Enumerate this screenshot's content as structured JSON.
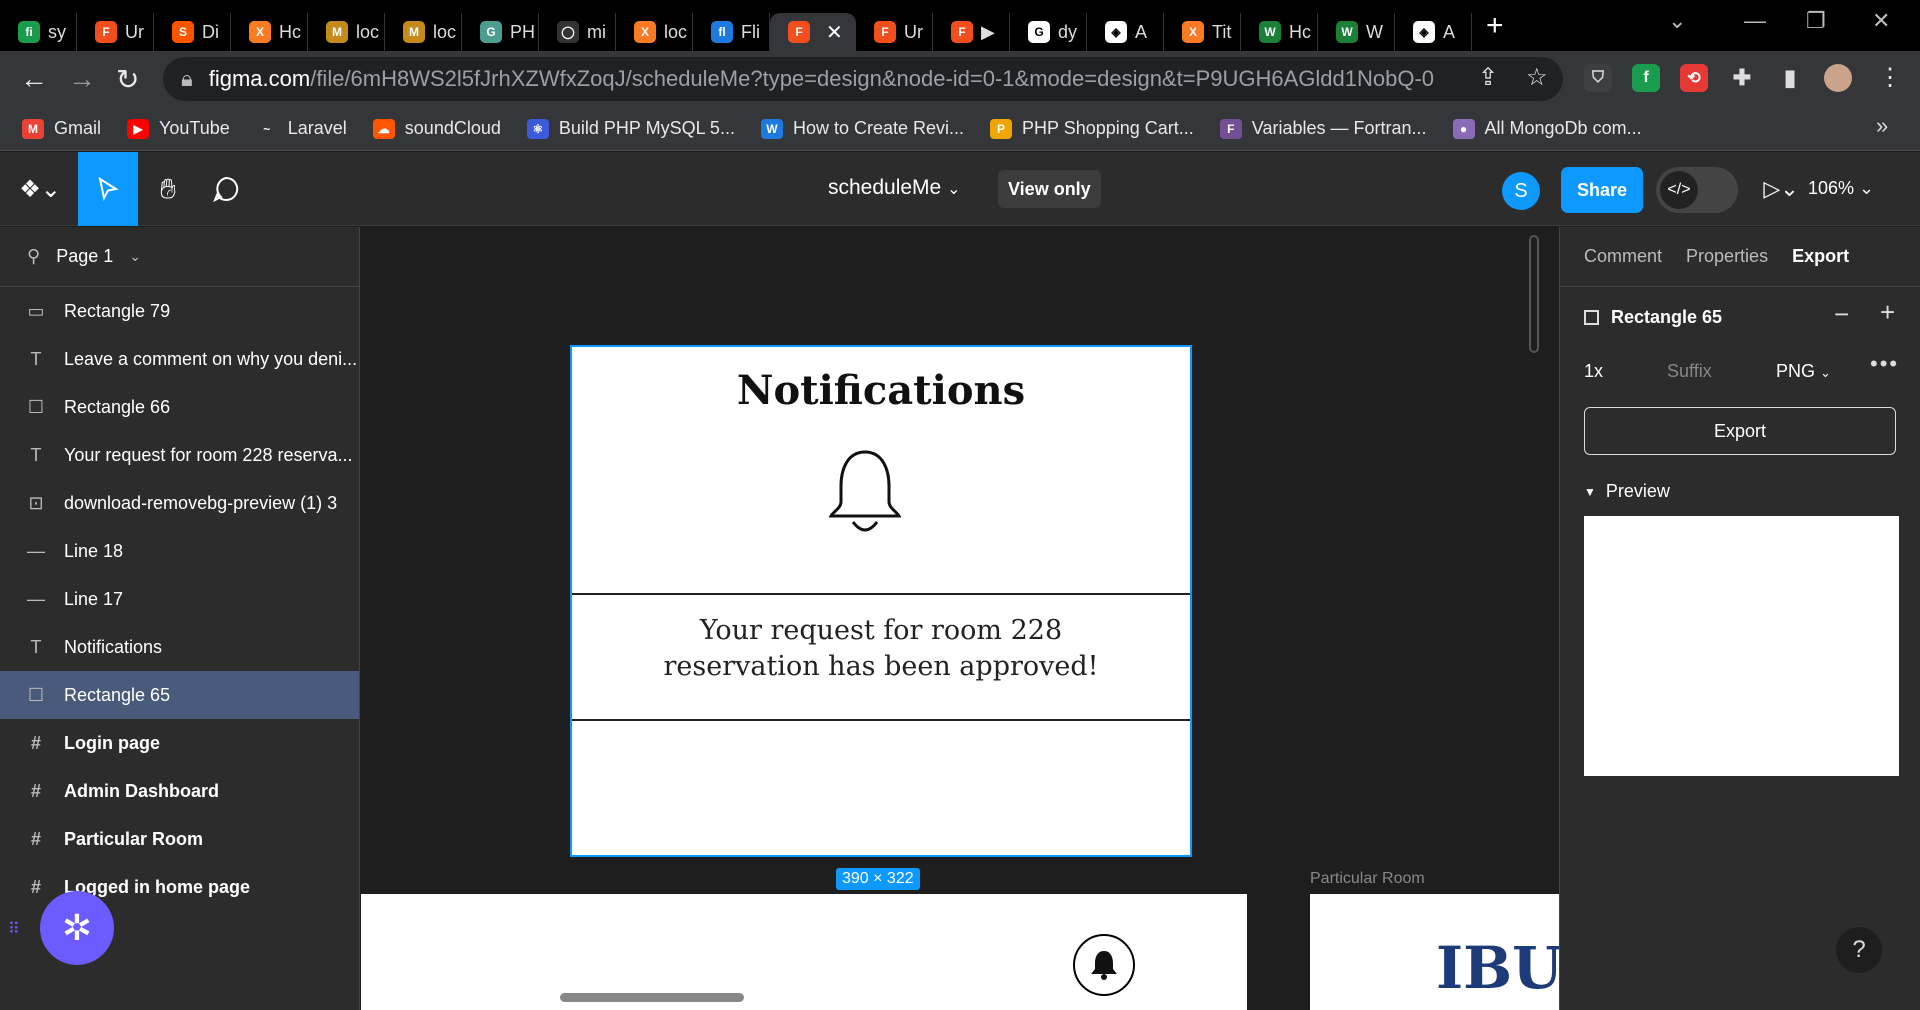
{
  "browser": {
    "tabs": [
      {
        "label": "sy",
        "icon_bg": "#1a9c4e",
        "icon": "fi"
      },
      {
        "label": "Ur",
        "icon_bg": "#f24e1e",
        "icon": "F"
      },
      {
        "label": "Di",
        "icon_bg": "#ff5500",
        "icon": "S"
      },
      {
        "label": "Hc",
        "icon_bg": "#fb7a24",
        "icon": "X"
      },
      {
        "label": "loc",
        "icon_bg": "#c48a1a",
        "icon": "M"
      },
      {
        "label": "loc",
        "icon_bg": "#c48a1a",
        "icon": "M"
      },
      {
        "label": "PH",
        "icon_bg": "#4a9d8f",
        "icon": "G"
      },
      {
        "label": "mi",
        "icon_bg": "#333333",
        "icon": "◯"
      },
      {
        "label": "loc",
        "icon_bg": "#fb7a24",
        "icon": "X"
      },
      {
        "label": "Fli",
        "icon_bg": "#1f7ae0",
        "icon": "fl"
      },
      {
        "label": "",
        "icon_bg": "#f24e1e",
        "icon": "F",
        "active": true
      },
      {
        "label": "Ur",
        "icon_bg": "#f24e1e",
        "icon": "F"
      },
      {
        "label": "▶",
        "icon_bg": "#f24e1e",
        "icon": "F"
      },
      {
        "label": "dy",
        "icon_bg": "#ffffff",
        "icon": "G"
      },
      {
        "label": "A",
        "icon_bg": "#ffffff",
        "icon": "◈"
      },
      {
        "label": "Tit",
        "icon_bg": "#fb7a24",
        "icon": "X"
      },
      {
        "label": "Hc",
        "icon_bg": "#1a7f37",
        "icon": "W"
      },
      {
        "label": "W",
        "icon_bg": "#1a7f37",
        "icon": "W"
      },
      {
        "label": "A",
        "icon_bg": "#ffffff",
        "icon": "◈"
      }
    ],
    "url_host": "figma.com",
    "url_path": "/file/6mH8WS2l5fJrhXZWfxZoqJ/scheduleMe?type=design&node-id=0-1&mode=design&t=P9UGH6AGldd1NobQ-0",
    "bookmarks": [
      {
        "label": "Gmail",
        "icon": "M",
        "icon_bg": "#ea4335"
      },
      {
        "label": "YouTube",
        "icon": "▶",
        "icon_bg": "#ff0000"
      },
      {
        "label": "Laravel",
        "icon": "~",
        "icon_bg": "#35363a"
      },
      {
        "label": "soundCloud",
        "icon": "☁",
        "icon_bg": "#ff5500"
      },
      {
        "label": "Build PHP MySQL 5...",
        "icon": "⚛",
        "icon_bg": "#3b5bdb"
      },
      {
        "label": "How to Create Revi...",
        "icon": "W",
        "icon_bg": "#1f7ae0"
      },
      {
        "label": "PHP Shopping Cart...",
        "icon": "P",
        "icon_bg": "#f0a500"
      },
      {
        "label": "Variables — Fortran...",
        "icon": "F",
        "icon_bg": "#734f96"
      },
      {
        "label": "All MongoDb com...",
        "icon": "●",
        "icon_bg": "#8a6bb8"
      }
    ]
  },
  "figma": {
    "file_title": "scheduleMe",
    "view_only": "View only",
    "avatar": "S",
    "share": "Share",
    "zoom": "106%",
    "page": "Page 1",
    "layers": [
      {
        "label": "Rectangle 79",
        "icon": "▭",
        "type": "rect"
      },
      {
        "label": "Leave a comment on why you deni...",
        "icon": "T",
        "type": "text"
      },
      {
        "label": "Rectangle 66",
        "icon": "☐",
        "type": "rect"
      },
      {
        "label": "Your request for room 228 reserva...",
        "icon": "T",
        "type": "text"
      },
      {
        "label": "download-removebg-preview (1) 3",
        "icon": "⊡",
        "type": "image"
      },
      {
        "label": "Line 18",
        "icon": "—",
        "type": "line"
      },
      {
        "label": "Line 17",
        "icon": "—",
        "type": "line"
      },
      {
        "label": "Notifications",
        "icon": "T",
        "type": "text"
      },
      {
        "label": "Rectangle 65",
        "icon": "☐",
        "type": "rect",
        "selected": true
      },
      {
        "label": "Login page",
        "icon": "#",
        "type": "frame"
      },
      {
        "label": "Admin Dashboard",
        "icon": "#",
        "type": "frame"
      },
      {
        "label": "Particular Room",
        "icon": "#",
        "type": "frame"
      },
      {
        "label": "Logged in home page",
        "icon": "#",
        "type": "frame"
      }
    ],
    "canvas": {
      "card_title": "Notifications",
      "card_message_line1": "Your request for room 228",
      "card_message_line2": "reservation has been approved!",
      "size_tag": "390 × 322",
      "frame_label": "Particular Room",
      "ibu_text": "IBU"
    },
    "right_panel": {
      "tabs": [
        "Comment",
        "Properties",
        "Export"
      ],
      "active_tab": "Export",
      "selection": "Rectangle 65",
      "scale": "1x",
      "suffix_placeholder": "Suffix",
      "format": "PNG",
      "export_btn": "Export",
      "preview": "Preview",
      "help": "?"
    }
  }
}
